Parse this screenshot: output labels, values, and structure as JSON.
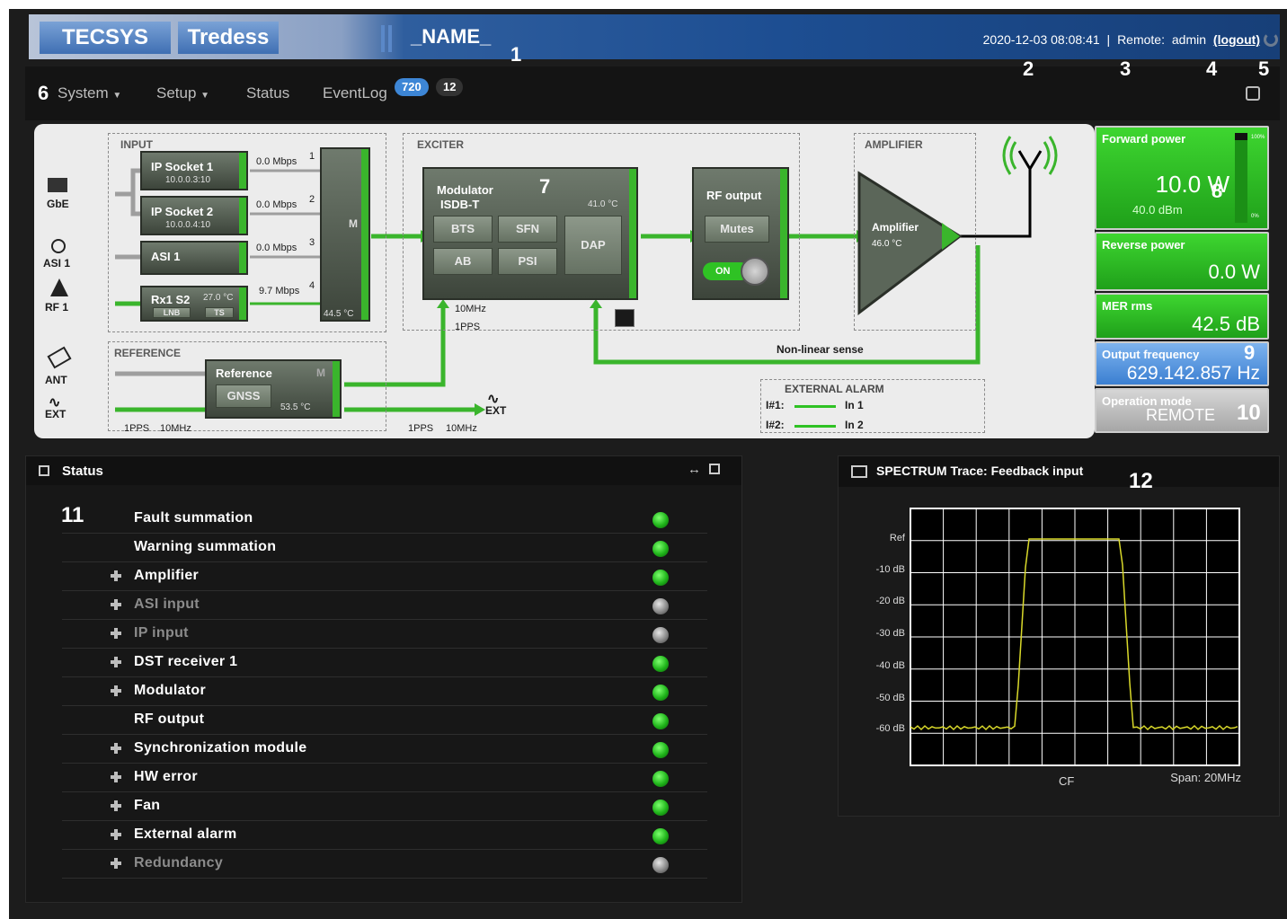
{
  "header": {
    "logo_tecsys": "TECSYS",
    "logo_tredess": "Tredess",
    "title": "_NAME_",
    "datetime": "2020-12-03 08:08:41",
    "separator": "|",
    "remote_label": "Remote:",
    "user": "admin",
    "logout": "(logout)"
  },
  "callouts": [
    "1",
    "2",
    "3",
    "4",
    "5",
    "6",
    "7",
    "8",
    "9",
    "10",
    "11",
    "12"
  ],
  "nav": {
    "items": [
      "System",
      "Setup",
      "Status",
      "EventLog"
    ],
    "badge_blue": "720",
    "badge_dark": "12"
  },
  "diagram": {
    "input": {
      "label": "INPUT",
      "gbe": "GbE",
      "asi1": "ASI 1",
      "rf1": "RF 1",
      "ip_socket_1": {
        "name": "IP Socket 1",
        "addr": "10.0.0.3:10",
        "rate": "0.0 Mbps",
        "port": "1"
      },
      "ip_socket_2": {
        "name": "IP Socket 2",
        "addr": "10.0.0.4:10",
        "rate": "0.0 Mbps",
        "port": "2"
      },
      "asi_block": {
        "name": "ASI 1",
        "rate": "0.0 Mbps",
        "port": "3"
      },
      "rx_block": {
        "name": "Rx1 S2",
        "temp": "27.0 °C",
        "lnb": "LNB",
        "ts": "TS",
        "rate": "9.7 Mbps",
        "port": "4"
      },
      "mux_letter": "M",
      "mux_temp": "44.5 °C"
    },
    "reference": {
      "label": "REFERENCE",
      "ant": "ANT",
      "ext": "EXT",
      "block": "Reference",
      "m": "M",
      "gnss": "GNSS",
      "temp": "53.5 °C",
      "in_1pps": "1PPS",
      "in_10mhz": "10MHz",
      "out_1pps": "1PPS",
      "out_10mhz": "10MHz",
      "out_ext": "EXT"
    },
    "exciter": {
      "label": "EXCITER",
      "modulator": "Modulator",
      "standard": "ISDB-T",
      "temp": "41.0 °C",
      "buttons": [
        "BTS",
        "SFN",
        "AB",
        "PSI"
      ],
      "dap": "DAP",
      "clk_10mhz": "10MHz",
      "clk_1pps": "1PPS",
      "rf_output": "RF output",
      "mutes": "Mutes",
      "on": "ON"
    },
    "amplifier": {
      "label": "AMPLIFIER",
      "name": "Amplifier",
      "temp": "46.0 °C"
    },
    "nonlinear": "Non-linear sense",
    "external_alarm": {
      "label": "EXTERNAL ALARM",
      "i1": "I#1:",
      "i1_name": "In 1",
      "i2": "I#2:",
      "i2_name": "In 2"
    }
  },
  "gauges": {
    "forward": {
      "title": "Forward power",
      "value": "10.0 W",
      "dbm": "40.0 dBm",
      "scale_top": "100%",
      "scale_bottom": "0%",
      "level": 0.92
    },
    "reverse": {
      "title": "Reverse power",
      "value": "0.0 W"
    },
    "mer": {
      "title": "MER rms",
      "value": "42.5 dB"
    },
    "frequency": {
      "title": "Output frequency",
      "value": "629.142.857 Hz"
    },
    "mode": {
      "title": "Operation mode",
      "value": "REMOTE"
    }
  },
  "status": {
    "title": "Status",
    "rows": [
      {
        "label": "Fault summation",
        "expandable": false,
        "state": "ok"
      },
      {
        "label": "Warning summation",
        "expandable": false,
        "state": "ok"
      },
      {
        "label": "Amplifier",
        "expandable": true,
        "state": "ok"
      },
      {
        "label": "ASI input",
        "expandable": true,
        "state": "off"
      },
      {
        "label": "IP input",
        "expandable": true,
        "state": "off"
      },
      {
        "label": "DST receiver 1",
        "expandable": true,
        "state": "ok"
      },
      {
        "label": "Modulator",
        "expandable": true,
        "state": "ok"
      },
      {
        "label": "RF output",
        "expandable": false,
        "state": "ok"
      },
      {
        "label": "Synchronization module",
        "expandable": true,
        "state": "ok"
      },
      {
        "label": "HW error",
        "expandable": true,
        "state": "ok"
      },
      {
        "label": "Fan",
        "expandable": true,
        "state": "ok"
      },
      {
        "label": "External alarm",
        "expandable": true,
        "state": "ok"
      },
      {
        "label": "Redundancy",
        "expandable": true,
        "state": "off"
      }
    ]
  },
  "spectrum": {
    "title": "SPECTRUM Trace: Feedback input",
    "y_labels": [
      "Ref",
      "-10 dB",
      "-20 dB",
      "-30 dB",
      "-40 dB",
      "-50 dB",
      "-60 dB"
    ],
    "x_center": "CF",
    "span": "Span: 20MHz"
  },
  "colors": {
    "accent_green": "#2fc224",
    "accent_blue": "#3b7fd1",
    "trace": "#d9d92a"
  }
}
